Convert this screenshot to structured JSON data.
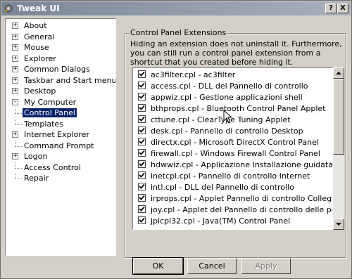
{
  "window": {
    "title": "Tweak UI",
    "help_label": "?",
    "close_label": "X"
  },
  "tree": {
    "items": [
      {
        "label": "About",
        "expander": "+",
        "selected": false
      },
      {
        "label": "General",
        "expander": "+",
        "selected": false
      },
      {
        "label": "Mouse",
        "expander": "+",
        "selected": false
      },
      {
        "label": "Explorer",
        "expander": "+",
        "selected": false
      },
      {
        "label": "Common Dialogs",
        "expander": "+",
        "selected": false
      },
      {
        "label": "Taskbar and Start menu",
        "expander": "+",
        "selected": false
      },
      {
        "label": "Desktop",
        "expander": "+",
        "selected": false
      },
      {
        "label": "My Computer",
        "expander": "-",
        "selected": false
      },
      {
        "label": "Control Panel",
        "expander": "",
        "selected": true
      },
      {
        "label": "Templates",
        "expander": "",
        "selected": false
      },
      {
        "label": "Internet Explorer",
        "expander": "+",
        "selected": false
      },
      {
        "label": "Command Prompt",
        "expander": "",
        "selected": false
      },
      {
        "label": "Logon",
        "expander": "+",
        "selected": false
      },
      {
        "label": "Access Control",
        "expander": "",
        "selected": false
      },
      {
        "label": "Repair",
        "expander": "",
        "selected": false
      }
    ]
  },
  "panel": {
    "group_title": "Control Panel Extensions",
    "description": "Hiding an extension does not uninstall it. Furthermore, you can still run a control panel extension from a shortcut that you created before hiding it."
  },
  "extensions": {
    "items": [
      {
        "label": "ac3filter.cpl - ac3filter",
        "checked": true
      },
      {
        "label": "access.cpl - DLL del Pannello di controllo",
        "checked": true
      },
      {
        "label": "appwiz.cpl - Gestione applicazioni shell",
        "checked": true
      },
      {
        "label": "bthprops.cpl - Bluetooth Control Panel Applet",
        "checked": true
      },
      {
        "label": "cttune.cpl - ClearType Tuning Applet",
        "checked": true
      },
      {
        "label": "desk.cpl - Pannello di controllo Desktop",
        "checked": true
      },
      {
        "label": "directx.cpl - Microsoft DirectX Control Panel",
        "checked": true
      },
      {
        "label": "firewall.cpl - Windows Firewall Control Panel",
        "checked": true
      },
      {
        "label": "hdwwiz.cpl - Applicazione Installazione guidata hardw",
        "checked": true
      },
      {
        "label": "inetcpl.cpl - Pannello di controllo Internet",
        "checked": true
      },
      {
        "label": "intl.cpl - DLL del Pannello di controllo",
        "checked": true
      },
      {
        "label": "irprops.cpl - Applet Pannello di controllo Collegamento",
        "checked": true
      },
      {
        "label": "joy.cpl - Applet del Pannello di controllo delle periferic",
        "checked": true
      },
      {
        "label": "jpicpl32.cpl - Java(TM) Control Panel",
        "checked": true
      }
    ]
  },
  "buttons": {
    "ok": "OK",
    "cancel": "Cancel",
    "apply": "Apply"
  },
  "icons": {
    "title": "gear-icon",
    "cursor": "mouse-pointer-icon"
  }
}
